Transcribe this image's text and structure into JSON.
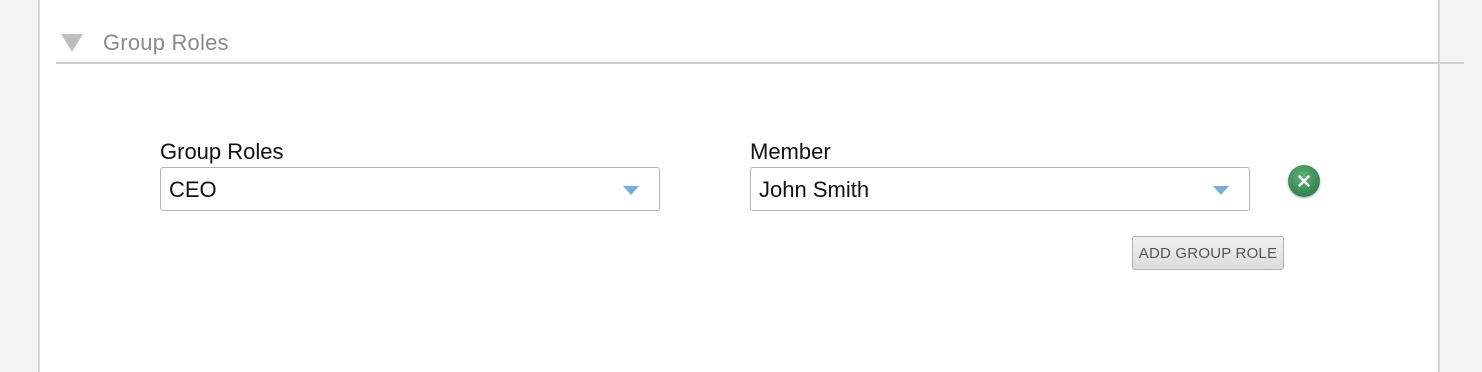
{
  "section": {
    "title": "Group Roles",
    "toggle_icon": "triangle-down-icon"
  },
  "form": {
    "group_roles_label": "Group Roles",
    "group_roles_value": "CEO",
    "member_label": "Member",
    "member_value": "John Smith",
    "dropdown_icon": "caret-down-icon",
    "remove_icon": "close-circle-icon",
    "add_button_label": "ADD GROUP ROLE"
  },
  "colors": {
    "remove_button": "#3b8f57",
    "dropdown_arrow": "#74b0d9",
    "section_title": "#8a8a8a"
  }
}
